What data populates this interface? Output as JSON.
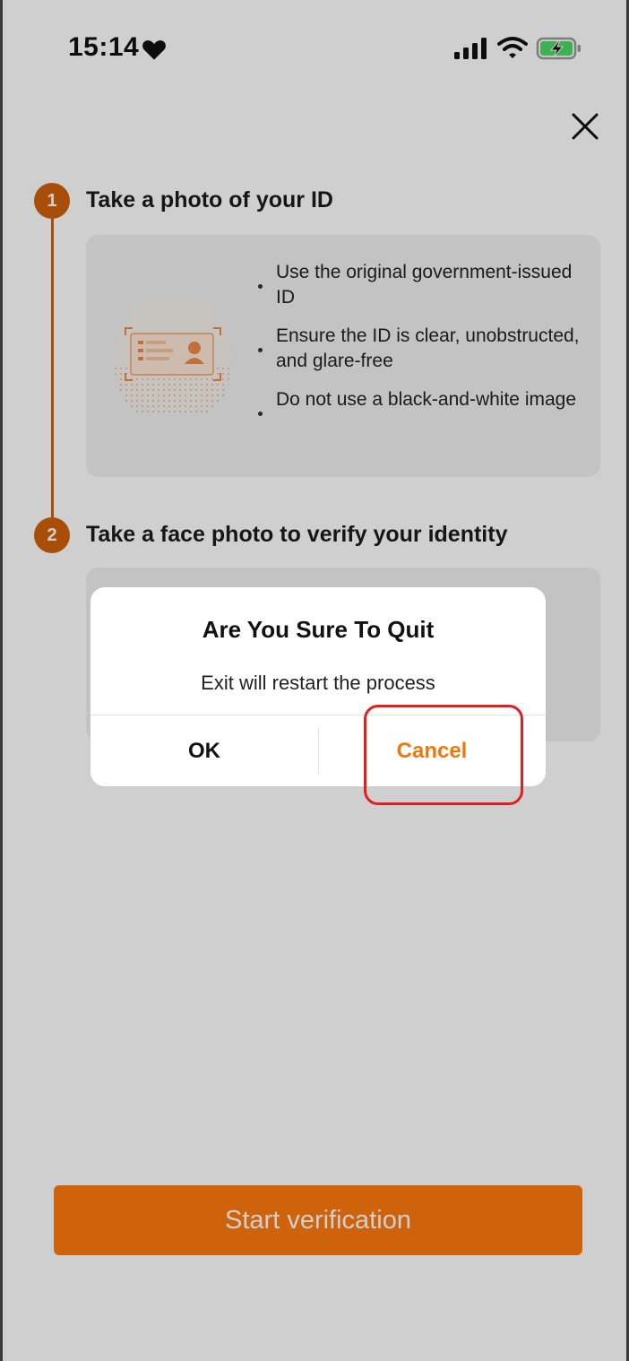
{
  "status_bar": {
    "time": "15:14",
    "icons": [
      "heart-icon",
      "cellular-signal-icon",
      "wifi-icon",
      "battery-charging-icon"
    ]
  },
  "colors": {
    "accent": "#d0600a",
    "primary_button": "#ff7a0e",
    "cancel_text": "#f0770b",
    "highlight_border": "#e02020"
  },
  "steps": [
    {
      "number": "1",
      "title": "Take a photo of your ID",
      "tips": [
        "Use the original government-issued ID",
        "Ensure the ID is clear, unobstructed, and glare-free",
        "Do not use a black-and-white image"
      ]
    },
    {
      "number": "2",
      "title": "Take a face photo to verify your identity"
    }
  ],
  "primary_button": {
    "label": "Start verification"
  },
  "dialog": {
    "title": "Are You Sure To Quit",
    "message": "Exit will restart the process",
    "ok_label": "OK",
    "cancel_label": "Cancel"
  }
}
